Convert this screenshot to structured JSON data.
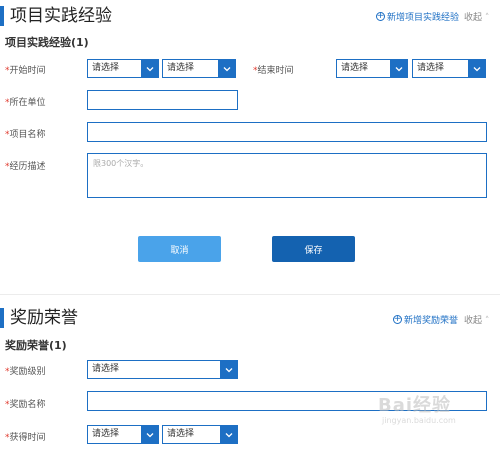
{
  "project": {
    "title": "项目实践经验",
    "add_label": "新增项目实践经验",
    "collapse_label": "收起",
    "subtitle": "项目实践经验(1)",
    "start_label": "开始时间",
    "end_label": "结束时间",
    "org_label": "所在单位",
    "name_label": "项目名称",
    "desc_label": "经历描述",
    "select_placeholder": "请选择",
    "desc_placeholder": "限300个汉字。",
    "cancel_label": "取消",
    "save_label": "保存"
  },
  "award": {
    "title": "奖励荣誉",
    "add_label": "新增奖励荣誉",
    "collapse_label": "收起",
    "subtitle": "奖励荣誉(1)",
    "level_label": "奖励级别",
    "name_label": "奖励名称",
    "time_label": "获得时间",
    "select_placeholder": "请选择"
  },
  "required_mark": "*",
  "watermark": {
    "text": "Bai经验",
    "url": "jingyan.baidu.com"
  },
  "colors": {
    "accent": "#1d6fc4",
    "cancel_button": "#4aa3ea",
    "save_button": "#1462b0",
    "required": "#e03b2f"
  }
}
